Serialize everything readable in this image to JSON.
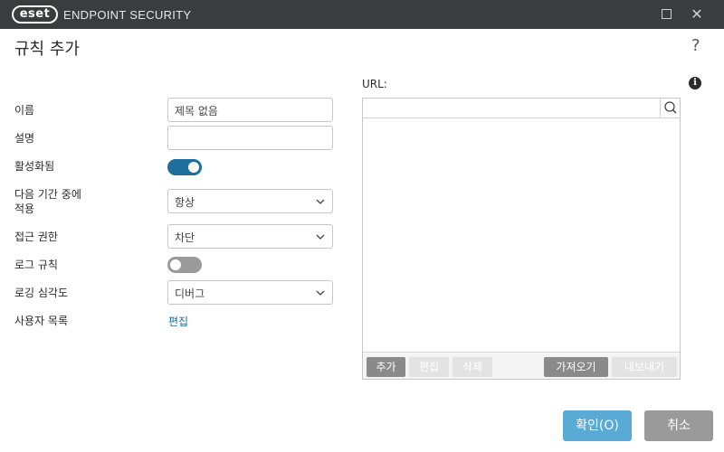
{
  "titlebar": {
    "logo": "eset",
    "product": "ENDPOINT SECURITY",
    "maximize_icon": "maximize-icon",
    "close_icon": "close-icon"
  },
  "dialog": {
    "title": "규칙 추가",
    "help": "?"
  },
  "form": {
    "name_label": "이름",
    "name_value": "제목 없음",
    "description_label": "설명",
    "description_value": "",
    "enabled_label": "활성화됨",
    "enabled": true,
    "apply_during_label_line1": "다음 기간 중에",
    "apply_during_label_line2": "적용",
    "apply_during_value": "항상",
    "access_label": "접근 권한",
    "access_value": "차단",
    "log_rule_label": "로그 규칙",
    "log_rule": false,
    "log_severity_label": "로깅 심각도",
    "log_severity_value": "디버그",
    "user_list_label": "사용자 목록",
    "user_list_link": "편집"
  },
  "url": {
    "label": "URL:",
    "search_value": "",
    "toolbar": {
      "add": "추가",
      "edit": "편집",
      "delete": "삭제",
      "import": "가져오기",
      "export": "내보내기"
    }
  },
  "buttons": {
    "ok": "확인(O)",
    "cancel": "취소"
  },
  "colors": {
    "titlebar": "#3a3c3f",
    "accent": "#1f6f9e",
    "ok": "#5aaad6",
    "cancel": "#9a9a9a"
  }
}
